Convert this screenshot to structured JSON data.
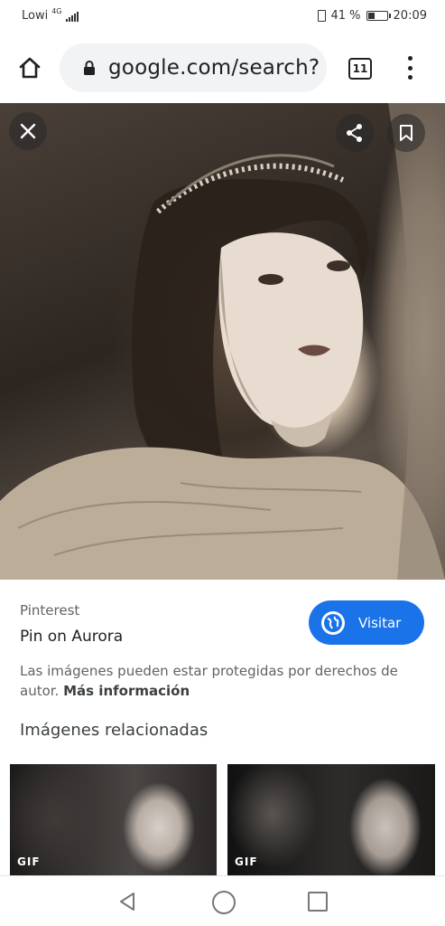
{
  "status_bar": {
    "carrier": "Lowi",
    "network": "4G",
    "battery_percent": "41 %",
    "battery_level": 0.41,
    "time": "20:09"
  },
  "browser": {
    "url": "google.com/search?",
    "tab_count": "11"
  },
  "result": {
    "source": "Pinterest",
    "title": "Pin on Aurora",
    "visit_label": "Visitar",
    "notice_text": "Las imágenes pueden estar protegidas por derechos de autor.",
    "more_info_link": "Más información"
  },
  "related": {
    "title": "Imágenes relacionadas",
    "items": [
      {
        "badge": "GIF"
      },
      {
        "badge": "GIF"
      }
    ]
  },
  "icons": {
    "home": "home-icon",
    "lock": "lock-icon",
    "menu": "more-vert-icon",
    "close": "close-icon",
    "share": "share-icon",
    "bookmark": "bookmark-icon",
    "globe": "globe-icon"
  },
  "colors": {
    "accent": "#1a73e8",
    "omnibox_bg": "#f1f3f4"
  }
}
